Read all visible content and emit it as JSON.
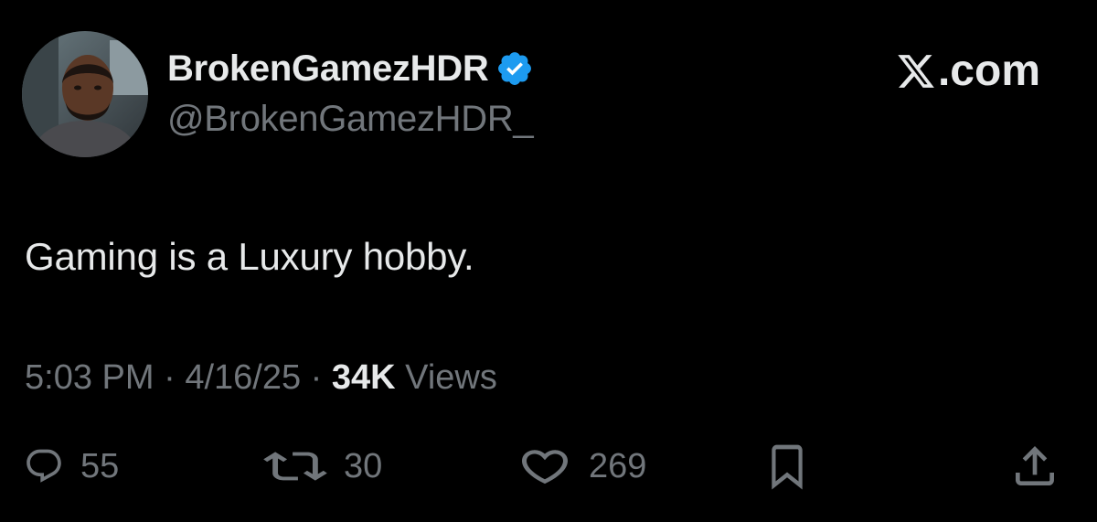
{
  "author": {
    "display_name": "BrokenGamezHDR",
    "handle": "@BrokenGamezHDR_",
    "verified": true,
    "avatar_icon": "profile-photo"
  },
  "source": {
    "label": ".com",
    "logo_icon": "x-logo-icon"
  },
  "tweet": {
    "text": "Gaming is a Luxury hobby."
  },
  "meta": {
    "time": "5:03 PM",
    "separator": " · ",
    "date": "4/16/25",
    "views_count": "34K",
    "views_label": " Views"
  },
  "actions": {
    "replies": "55",
    "reposts": "30",
    "likes": "269"
  },
  "colors": {
    "background": "#000000",
    "primary_text": "#e7e9ea",
    "secondary_text": "#71767b",
    "verified_blue": "#1d9bf0"
  }
}
